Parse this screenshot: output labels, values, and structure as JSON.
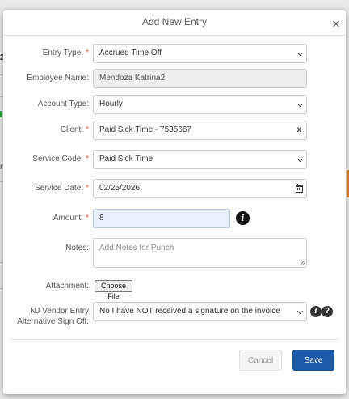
{
  "background": {
    "fragments": [
      "2",
      "n"
    ]
  },
  "modal": {
    "title": "Add New Entry",
    "close_symbol": "×"
  },
  "form": {
    "entry_type": {
      "label": "Entry Type:",
      "value": "Accrued Time Off",
      "required": true
    },
    "employee_name": {
      "label": "Employee Name:",
      "value": "Mendoza Katrina2"
    },
    "account_type": {
      "label": "Account Type:",
      "value": "Hourly"
    },
    "client": {
      "label": "Client:",
      "value": "Paid Sick Time - 7535667",
      "clear_symbol": "x",
      "required": true
    },
    "service_code": {
      "label": "Service Code:",
      "value": "Paid Sick Time",
      "required": true
    },
    "service_date": {
      "label": "Service Date:",
      "value": "02/25/2026",
      "required": true
    },
    "amount": {
      "label": "Amount:",
      "value": "8",
      "required": true,
      "info_icon": "info-icon"
    },
    "notes": {
      "label": "Notes:",
      "placeholder": "Add Notes for Punch"
    },
    "attachment": {
      "label": "Attachment:",
      "button_label": "Choose File"
    },
    "nj_vendor": {
      "label_line1": "NJ Vendor Entry",
      "label_line2": "Alternative Sign Off:",
      "value": "No I have NOT received a signature on the invoice",
      "icons": [
        "info-icon",
        "help-icon"
      ]
    },
    "required_marker": "*"
  },
  "footer": {
    "cancel_label": "Cancel",
    "save_label": "Save"
  },
  "colors": {
    "primary": "#1a5aa8",
    "required": "#d9534f",
    "highlight_bg": "#e8f0fe"
  }
}
